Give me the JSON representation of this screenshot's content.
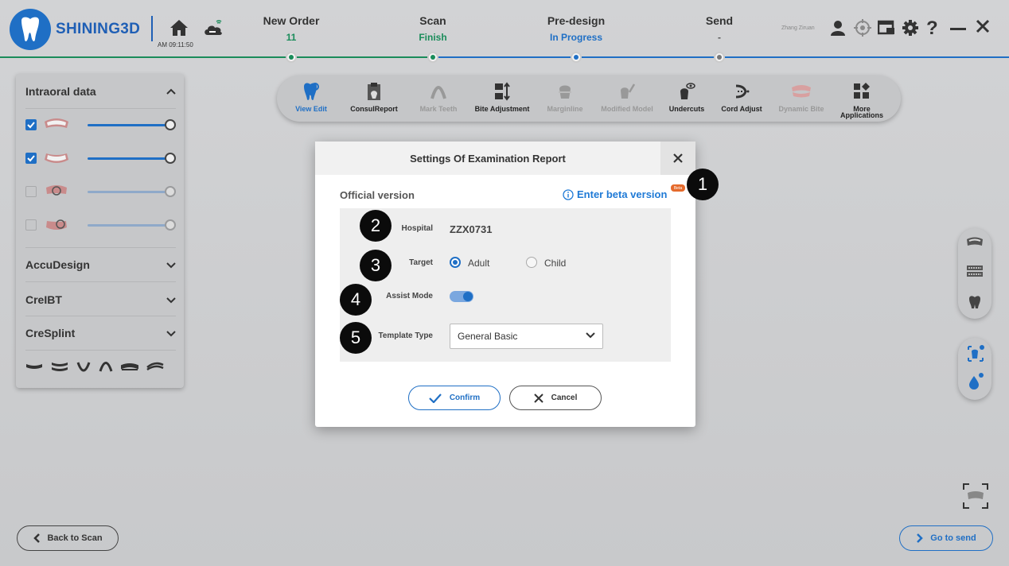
{
  "brand": {
    "name": "SHINING3D",
    "color": "#1f6fc5"
  },
  "header": {
    "clock": "AM 09:11:50",
    "user_name": "Zhang Ziruan",
    "steps": [
      {
        "title": "New Order",
        "status": "11",
        "status_color": "#1a8c5a"
      },
      {
        "title": "Scan",
        "status": "Finish",
        "status_color": "#1a8c5a"
      },
      {
        "title": "Pre-design",
        "status": "In Progress",
        "status_color": "#1f6fc5"
      },
      {
        "title": "Send",
        "status": "-",
        "status_color": "#555555"
      }
    ]
  },
  "left_panel": {
    "section_intraoral": "Intraoral data",
    "section_accudesign": "AccuDesign",
    "section_crelbt": "CreIBT",
    "section_cresplint": "CreSplint",
    "layers": [
      {
        "checked": true,
        "opacity": 1.0
      },
      {
        "checked": true,
        "opacity": 1.0
      },
      {
        "checked": false,
        "opacity": 1.0
      },
      {
        "checked": false,
        "opacity": 1.0
      }
    ]
  },
  "toolbar": {
    "items": [
      {
        "label": "View Edit",
        "state": "active"
      },
      {
        "label": "ConsulReport",
        "state": "normal"
      },
      {
        "label": "Mark Teeth",
        "state": "disabled"
      },
      {
        "label": "Bite Adjustment",
        "state": "normal"
      },
      {
        "label": "Marginline",
        "state": "disabled"
      },
      {
        "label": "Modified Model",
        "state": "disabled"
      },
      {
        "label": "Undercuts",
        "state": "normal"
      },
      {
        "label": "Cord Adjust",
        "state": "normal"
      },
      {
        "label": "Dynamic Bite",
        "state": "disabled"
      },
      {
        "label": "More Applications",
        "state": "normal"
      }
    ]
  },
  "dialog": {
    "title": "Settings Of Examination Report",
    "version_label": "Official version",
    "beta_link": "Enter beta version",
    "beta_badge": "Beta",
    "hospital_label": "Hospital",
    "hospital_value": "ZZX0731",
    "target_label": "Target",
    "target_options": [
      "Adult",
      "Child"
    ],
    "target_selected": "Adult",
    "assist_label": "Assist Mode",
    "assist_on": true,
    "template_label": "Template Type",
    "template_value": "General Basic",
    "confirm_label": "Confirm",
    "cancel_label": "Cancel"
  },
  "markers": [
    "1",
    "2",
    "3",
    "4",
    "5"
  ],
  "footer": {
    "back_label": "Back to Scan",
    "send_label": "Go to send"
  }
}
